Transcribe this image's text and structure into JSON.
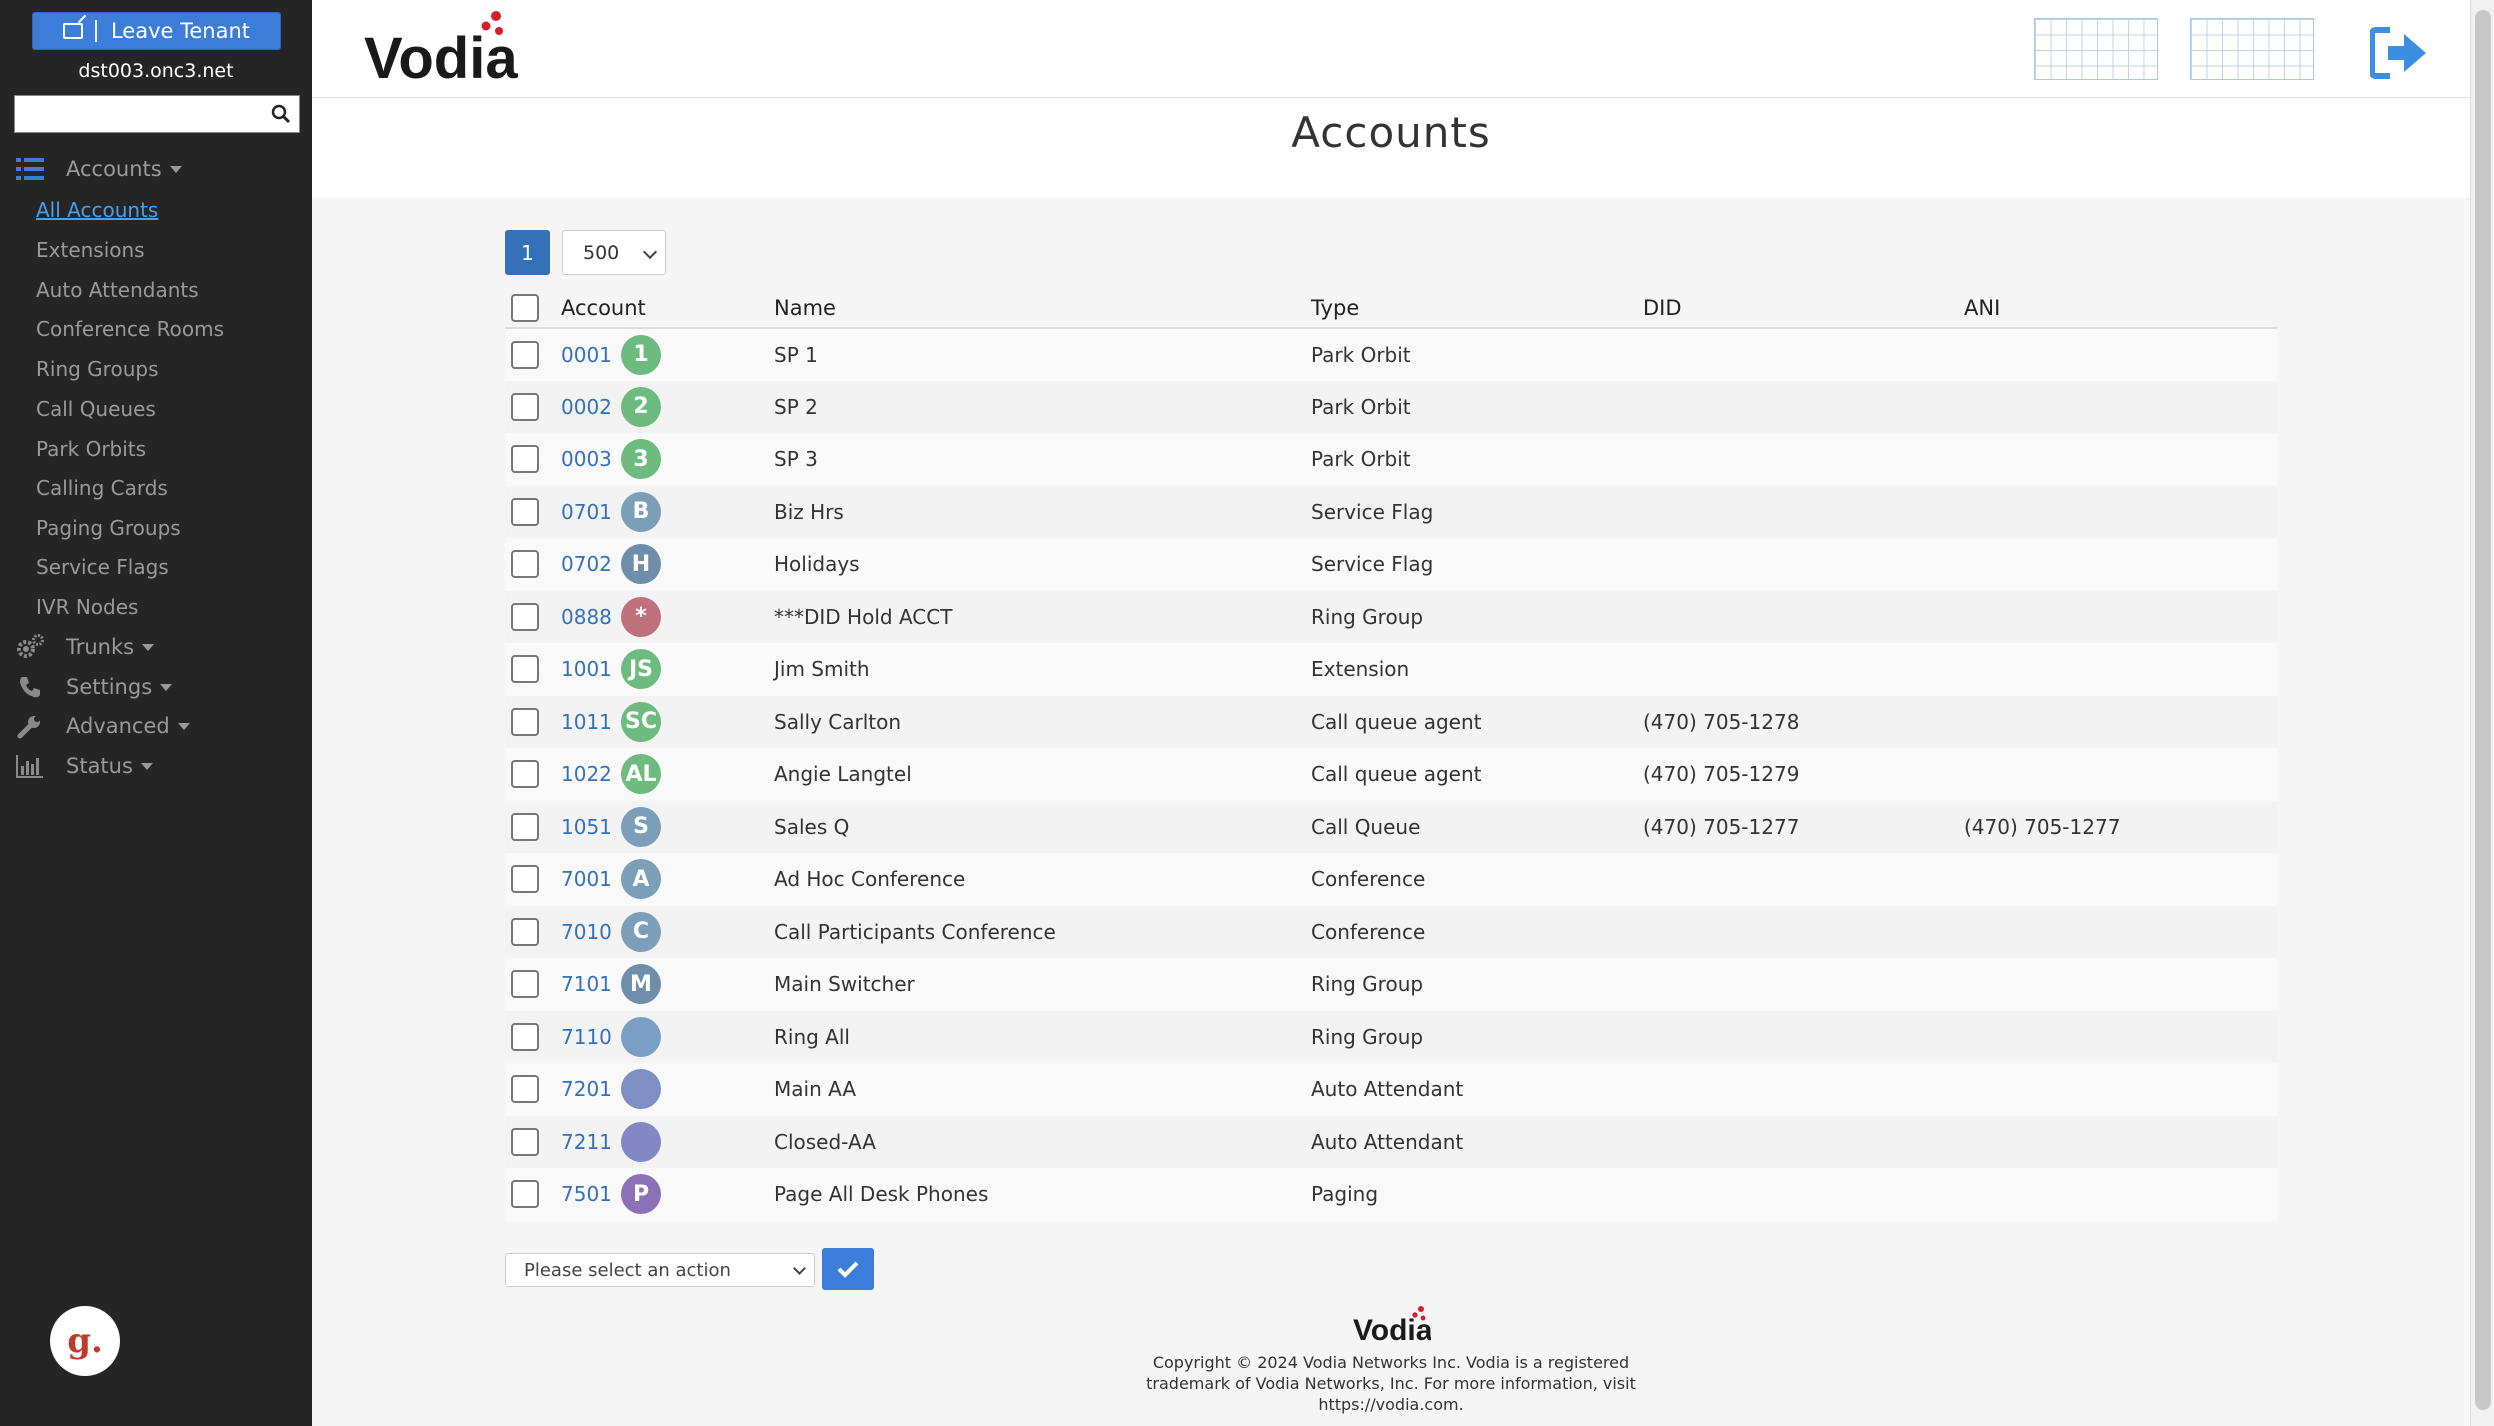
{
  "sidebar": {
    "leave_button": "Leave Tenant",
    "tenant": "dst003.onc3.net",
    "search_placeholder": "",
    "sections": {
      "accounts": "Accounts",
      "trunks": "Trunks",
      "settings": "Settings",
      "advanced": "Advanced",
      "status": "Status"
    },
    "items": [
      {
        "label": "All Accounts",
        "active": true
      },
      {
        "label": "Extensions"
      },
      {
        "label": "Auto Attendants"
      },
      {
        "label": "Conference Rooms"
      },
      {
        "label": "Ring Groups"
      },
      {
        "label": "Call Queues"
      },
      {
        "label": "Park Orbits"
      },
      {
        "label": "Calling Cards"
      },
      {
        "label": "Paging Groups"
      },
      {
        "label": "Service Flags"
      },
      {
        "label": "IVR Nodes"
      }
    ],
    "badge_letter": "g."
  },
  "header": {
    "logo_text": "Vodia",
    "page_title": "Accounts"
  },
  "pagination": {
    "current_page": "1",
    "page_size": "500"
  },
  "table": {
    "columns": {
      "account": "Account",
      "name": "Name",
      "type": "Type",
      "did": "DID",
      "ani": "ANI"
    },
    "rows": [
      {
        "account": "0001",
        "avatar": "1",
        "color": "#6dbb7e",
        "name": "SP 1",
        "type": "Park Orbit",
        "did": "",
        "ani": ""
      },
      {
        "account": "0002",
        "avatar": "2",
        "color": "#6dbb7e",
        "name": "SP 2",
        "type": "Park Orbit",
        "did": "",
        "ani": ""
      },
      {
        "account": "0003",
        "avatar": "3",
        "color": "#6dbb7e",
        "name": "SP 3",
        "type": "Park Orbit",
        "did": "",
        "ani": ""
      },
      {
        "account": "0701",
        "avatar": "B",
        "color": "#7b9fb8",
        "name": "Biz Hrs",
        "type": "Service Flag",
        "did": "",
        "ani": ""
      },
      {
        "account": "0702",
        "avatar": "H",
        "color": "#6f8eab",
        "name": "Holidays",
        "type": "Service Flag",
        "did": "",
        "ani": ""
      },
      {
        "account": "0888",
        "avatar": "*",
        "color": "#c0717e",
        "name": "***DID Hold ACCT",
        "type": "Ring Group",
        "did": "",
        "ani": ""
      },
      {
        "account": "1001",
        "avatar": "JS",
        "color": "#6dbb7e",
        "name": "Jim Smith",
        "type": "Extension",
        "did": "",
        "ani": ""
      },
      {
        "account": "1011",
        "avatar": "SC",
        "color": "#6dbb7e",
        "name": "Sally Carlton",
        "type": "Call queue agent",
        "did": "(470) 705-1278",
        "ani": ""
      },
      {
        "account": "1022",
        "avatar": "AL",
        "color": "#6dbb7e",
        "name": "Angie Langtel",
        "type": "Call queue agent",
        "did": "(470) 705-1279",
        "ani": ""
      },
      {
        "account": "1051",
        "avatar": "S",
        "color": "#7b9fb8",
        "name": "Sales Q",
        "type": "Call Queue",
        "did": "(470) 705-1277",
        "ani": "(470) 705-1277"
      },
      {
        "account": "7001",
        "avatar": "A",
        "color": "#7b9fb8",
        "name": "Ad Hoc Conference",
        "type": "Conference",
        "did": "",
        "ani": ""
      },
      {
        "account": "7010",
        "avatar": "C",
        "color": "#7b9fb8",
        "name": "Call Participants Conference",
        "type": "Conference",
        "did": "",
        "ani": ""
      },
      {
        "account": "7101",
        "avatar": "M",
        "color": "#6f8eab",
        "name": "Main Switcher",
        "type": "Ring Group",
        "did": "",
        "ani": ""
      },
      {
        "account": "7110",
        "avatar": "",
        "color": "#7b9fc4",
        "name": "Ring All",
        "type": "Ring Group",
        "did": "",
        "ani": ""
      },
      {
        "account": "7201",
        "avatar": "",
        "color": "#7f8fc4",
        "name": "Main AA",
        "type": "Auto Attendant",
        "did": "",
        "ani": ""
      },
      {
        "account": "7211",
        "avatar": "",
        "color": "#8487c6",
        "name": "Closed-AA",
        "type": "Auto Attendant",
        "did": "",
        "ani": ""
      },
      {
        "account": "7501",
        "avatar": "P",
        "color": "#8b72b8",
        "name": "Page All Desk Phones",
        "type": "Paging",
        "did": "",
        "ani": ""
      }
    ]
  },
  "actions": {
    "select_placeholder": "Please select an action"
  },
  "footer": {
    "logo_text": "Vodia",
    "line1": "Copyright © 2024 Vodia Networks Inc. Vodia is a registered",
    "line2": "trademark of Vodia Networks, Inc. For more information, visit",
    "line3": "https://vodia.com."
  },
  "colors": {
    "sidebar_bg": "#252525",
    "accent": "#3b7dd8",
    "link": "#3571b8",
    "active_nav": "#4a9eea",
    "logo_dots": "#d0202e"
  }
}
